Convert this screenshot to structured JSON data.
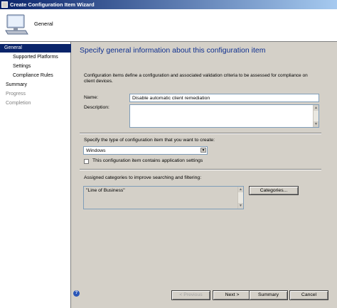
{
  "window": {
    "title": "Create Configuration Item Wizard"
  },
  "header": {
    "title": "General"
  },
  "nav": {
    "items": [
      {
        "label": "General",
        "state": "selected"
      },
      {
        "label": "Supported Platforms",
        "state": "normal"
      },
      {
        "label": "Settings",
        "state": "normal"
      },
      {
        "label": "Compliance Rules",
        "state": "normal"
      },
      {
        "label": "Summary",
        "state": "normal"
      },
      {
        "label": "Progress",
        "state": "disabled"
      },
      {
        "label": "Completion",
        "state": "disabled"
      }
    ]
  },
  "main": {
    "heading": "Specify general information about this configuration item",
    "description": "Configuration items define a configuration and associated validation criteria to be assessed for compliance on client devices.",
    "name_label": "Name:",
    "name_value": "Disable automatic client remediation",
    "description_label": "Description:",
    "description_value": "",
    "type_prompt": "Specify the type of configuration item that you want to create:",
    "type_value": "Windows",
    "app_settings_label": "This configuration item contains application settings",
    "app_settings_checked": false,
    "categories_label": "Assigned categories to improve searching and filtering:",
    "categories_value": "\"Line of Business\"",
    "categories_button": "Categories..."
  },
  "footer": {
    "help_icon": "help-icon",
    "previous": "< Previous",
    "next": "Next >",
    "summary": "Summary",
    "cancel": "Cancel"
  },
  "colors": {
    "nav_selected": "#0a246a",
    "heading": "#0e2f8f"
  }
}
